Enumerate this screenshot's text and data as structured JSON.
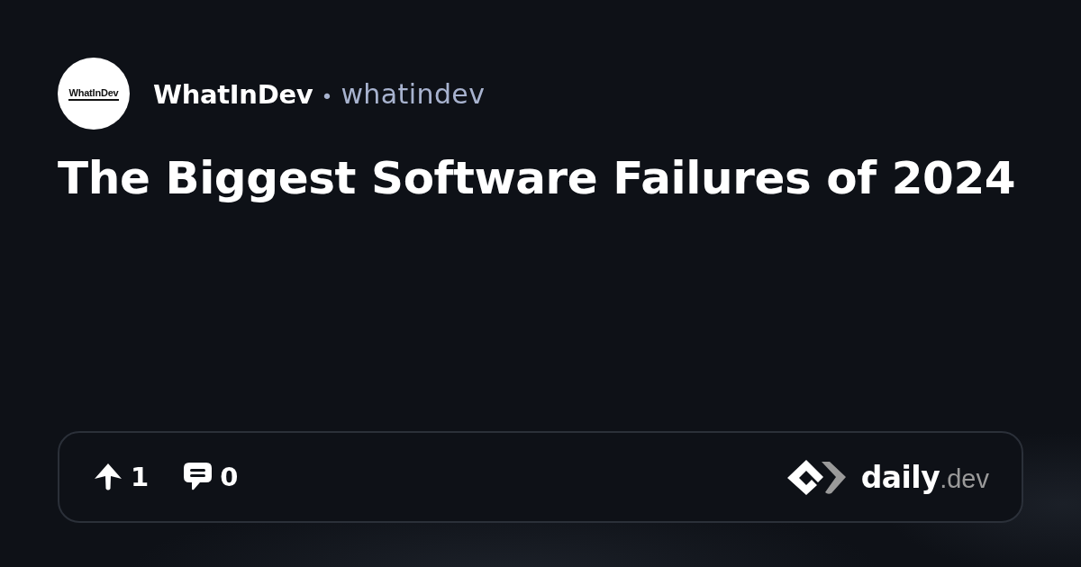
{
  "author": {
    "avatar_text": "WhatInDev",
    "name": "WhatInDev",
    "separator": "•",
    "handle": "whatindev"
  },
  "title": "The Biggest Software Failures of 2024",
  "stats": {
    "upvotes": "1",
    "comments": "0"
  },
  "brand": {
    "name": "daily",
    "suffix": ".dev"
  }
}
